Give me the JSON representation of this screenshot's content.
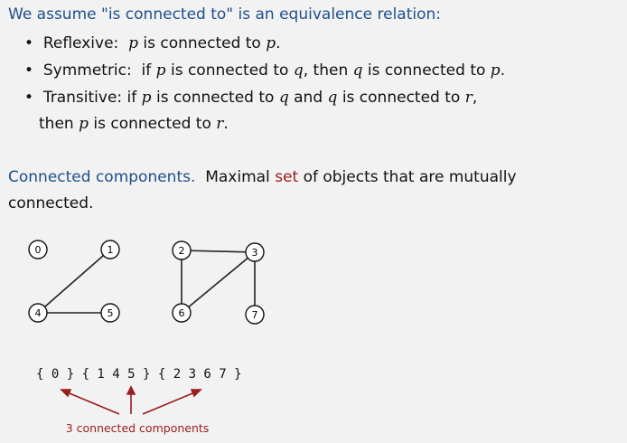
{
  "heading": "We assume \"is connected to\" is an equivalence relation:",
  "bullets": [
    {
      "label": "Reflexive:",
      "parts": [
        "p",
        " is connected to ",
        "p",
        "."
      ]
    },
    {
      "label": "Symmetric:",
      "parts": [
        "if ",
        "p",
        " is connected to ",
        "q",
        ", then ",
        "q",
        " is connected to ",
        "p",
        "."
      ]
    },
    {
      "label": "Transitive:",
      "parts": [
        "if ",
        "p",
        " is connected to ",
        "q",
        " and ",
        "q",
        " is connected to ",
        "r",
        ","
      ]
    },
    {
      "label": "",
      "parts": [
        "then ",
        "p",
        " is connected to ",
        "r",
        "."
      ]
    }
  ],
  "definition": {
    "term": "Connected components.",
    "pre": "Maximal ",
    "highlight": "set",
    "post": " of objects that are mutually",
    "line2": "connected."
  },
  "graph": {
    "nodes": [
      "0",
      "1",
      "2",
      "3",
      "4",
      "5",
      "6",
      "7"
    ],
    "edges": [
      [
        "1",
        "4"
      ],
      [
        "4",
        "5"
      ],
      [
        "2",
        "3"
      ],
      [
        "2",
        "6"
      ],
      [
        "3",
        "6"
      ],
      [
        "3",
        "7"
      ]
    ]
  },
  "sets": "{ 0 } { 1 4 5 } { 2 3 6 7 }",
  "annotation": "3 connected components",
  "colors": {
    "heading": "#1e4f8c",
    "highlight": "#9b1c1c"
  }
}
